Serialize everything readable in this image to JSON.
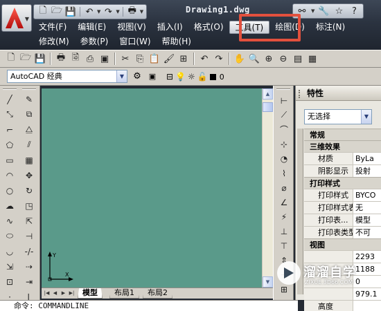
{
  "title_bar": {
    "document_title": "Drawing1.dwg",
    "app_icon": "autocad-logo-icon",
    "quick_access": [
      "new-icon",
      "open-icon",
      "save-icon",
      "undo-icon",
      "redo-icon",
      "print-icon"
    ]
  },
  "menu": {
    "row1": [
      {
        "label": "文件(F)"
      },
      {
        "label": "编辑(E)"
      },
      {
        "label": "视图(V)"
      },
      {
        "label": "插入(I)"
      },
      {
        "label": "格式(O)"
      },
      {
        "label": "工具(T)",
        "active": true
      },
      {
        "label": "绘图(D)"
      },
      {
        "label": "标注(N)"
      }
    ],
    "row2": [
      {
        "label": "修改(M)"
      },
      {
        "label": "参数(P)"
      },
      {
        "label": "窗口(W)"
      },
      {
        "label": "帮助(H)"
      }
    ],
    "highlight_color": "#e2503d"
  },
  "workspace": {
    "selected": "AutoCAD 经典",
    "layer_value": "0"
  },
  "layout_tabs": [
    {
      "label": "模型",
      "active": true
    },
    {
      "label": "布局1",
      "active": false
    },
    {
      "label": "布局2",
      "active": false
    }
  ],
  "command_line": {
    "text": "命令: COMMANDLINE"
  },
  "properties": {
    "title": "特性",
    "selection": "无选择",
    "sections": [
      {
        "title": "常规",
        "rows": []
      },
      {
        "title": "三维效果",
        "rows": [
          {
            "key": "材质",
            "value": "ByLa"
          },
          {
            "key": "阴影显示",
            "value": "投射"
          }
        ]
      },
      {
        "title": "打印样式",
        "rows": [
          {
            "key": "打印样式",
            "value": "BYCO"
          },
          {
            "key": "打印样式表",
            "value": "无"
          },
          {
            "key": "打印表...",
            "value": "模型"
          },
          {
            "key": "打印表类型",
            "value": "不可"
          }
        ]
      },
      {
        "title": "视图",
        "rows": [
          {
            "key": "",
            "value": "2293"
          },
          {
            "key": "",
            "value": "1188"
          },
          {
            "key": "",
            "value": "0"
          },
          {
            "key": "",
            "value": "979.1"
          },
          {
            "key": "高度",
            "value": ""
          }
        ]
      }
    ]
  },
  "ucs": {
    "y_label": "Y",
    "x_label": "X"
  },
  "watermark": {
    "brand": "溜溜自学",
    "url": "ZIXUE.3D66.COM"
  },
  "colors": {
    "drawing_bg": "#5a9a8a",
    "chrome": "#d4d0c8",
    "title_dark": "#2b3340"
  }
}
